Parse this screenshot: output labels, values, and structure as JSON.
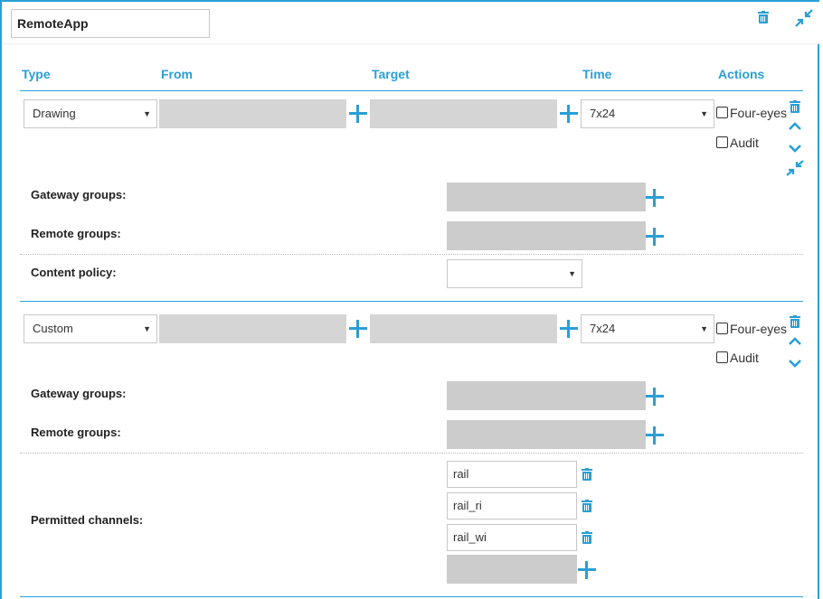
{
  "header": {
    "name_value": "RemoteApp"
  },
  "columns": {
    "type": "Type",
    "from": "From",
    "target": "Target",
    "time": "Time",
    "actions": "Actions"
  },
  "rule1": {
    "type_value": "Drawing",
    "time_value": "7x24",
    "four_eyes": "Four-eyes",
    "audit": "Audit",
    "gateway_groups": "Gateway groups:",
    "remote_groups": "Remote groups:",
    "content_policy": "Content policy:",
    "content_policy_value": ""
  },
  "rule2": {
    "type_value": "Custom",
    "time_value": "7x24",
    "four_eyes": "Four-eyes",
    "audit": "Audit",
    "gateway_groups": "Gateway groups:",
    "remote_groups": "Remote groups:",
    "permitted_channels": "Permitted channels:",
    "channels": [
      "rail",
      "rail_ri",
      "rail_wi"
    ]
  },
  "colors": {
    "accent": "#2a9fd6",
    "field_gray": "#d5d5d5",
    "border": "#c8c8c8"
  },
  "icons": {
    "delete": "trash-icon",
    "collapse": "collapse-arrows-icon",
    "up": "chevron-up-icon",
    "down": "chevron-down-icon",
    "add": "plus-icon"
  }
}
